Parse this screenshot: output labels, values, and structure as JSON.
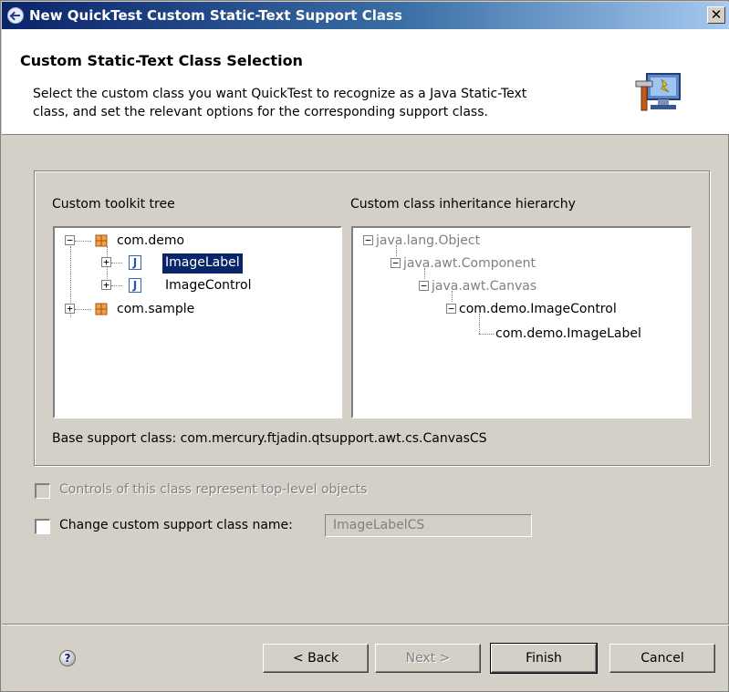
{
  "window": {
    "title": "New QuickTest Custom Static-Text Support Class",
    "close_glyph": "✕"
  },
  "header": {
    "heading": "Custom Static-Text Class Selection",
    "description_line1": "Select the custom class you want QuickTest to recognize as a Java Static-Text",
    "description_line2": "class, and set the relevant options for the corresponding support class.",
    "icon": "wizard-hammer-monitor-icon"
  },
  "toolkit_tree": {
    "label": "Custom toolkit tree",
    "nodes": [
      {
        "label": "com.demo",
        "expander": "−",
        "icon": "package-icon"
      },
      {
        "label": "ImageLabel",
        "expander": "+",
        "icon": "java-class-icon",
        "selected": true
      },
      {
        "label": "ImageControl",
        "expander": "+",
        "icon": "java-class-icon"
      },
      {
        "label": "com.sample",
        "expander": "+",
        "icon": "package-icon"
      }
    ],
    "class_icon_letter": "J"
  },
  "hierarchy": {
    "label": "Custom class inheritance hierarchy",
    "nodes": [
      {
        "label": "java.lang.Object",
        "expander": "−",
        "disabled": true
      },
      {
        "label": "java.awt.Component",
        "expander": "−",
        "disabled": true
      },
      {
        "label": "java.awt.Canvas",
        "expander": "−",
        "disabled": true
      },
      {
        "label": "com.demo.ImageControl",
        "expander": "−",
        "disabled": false
      },
      {
        "label": "com.demo.ImageLabel",
        "disabled": false
      }
    ]
  },
  "base_support_class": "Base support class: com.mercury.ftjadin.qtsupport.awt.cs.CanvasCS",
  "options": {
    "top_level_label": "Controls of this class represent top-level objects",
    "top_level_checked": false,
    "change_name_label": "Change custom support class name:",
    "change_name_checked": false,
    "class_name_value": "ImageLabelCS"
  },
  "buttons": {
    "help": "?",
    "back": "< Back",
    "next": "Next >",
    "finish": "Finish",
    "cancel": "Cancel"
  }
}
